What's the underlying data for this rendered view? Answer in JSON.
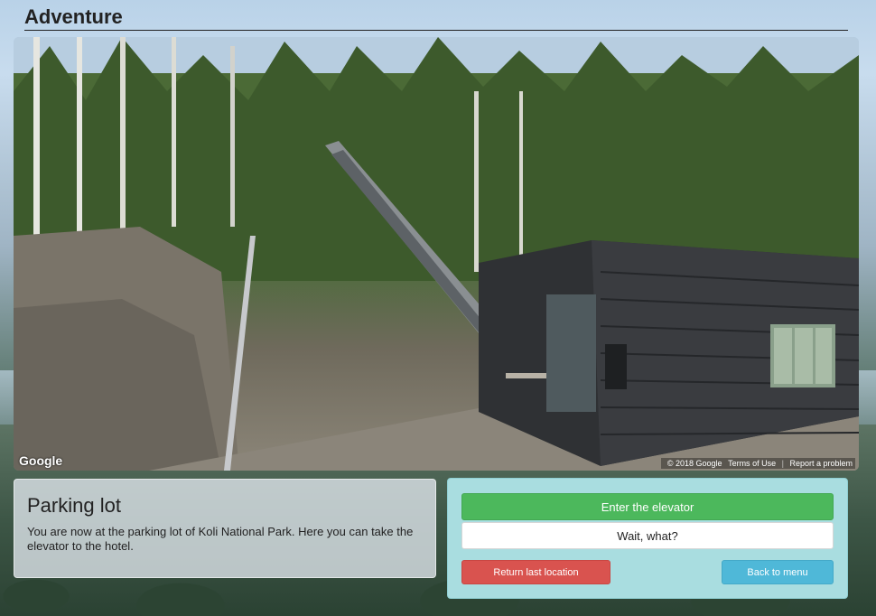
{
  "page": {
    "title": "Adventure"
  },
  "panorama": {
    "logo": "Google",
    "copyright": "© 2018 Google",
    "terms_link": "Terms of Use",
    "report_link": "Report a problem"
  },
  "location": {
    "title": "Parking lot",
    "description": "You are now at the parking lot of Koli National Park. Here you can take the elevator to the hotel."
  },
  "actions": {
    "primary": "Enter the elevator",
    "secondary": "Wait, what?",
    "return_label": "Return last location",
    "menu_label": "Back to menu"
  },
  "colors": {
    "green": "#4cb85c",
    "red": "#d9534f",
    "blue": "#4fb8d8",
    "panel": "#a9dde0"
  }
}
